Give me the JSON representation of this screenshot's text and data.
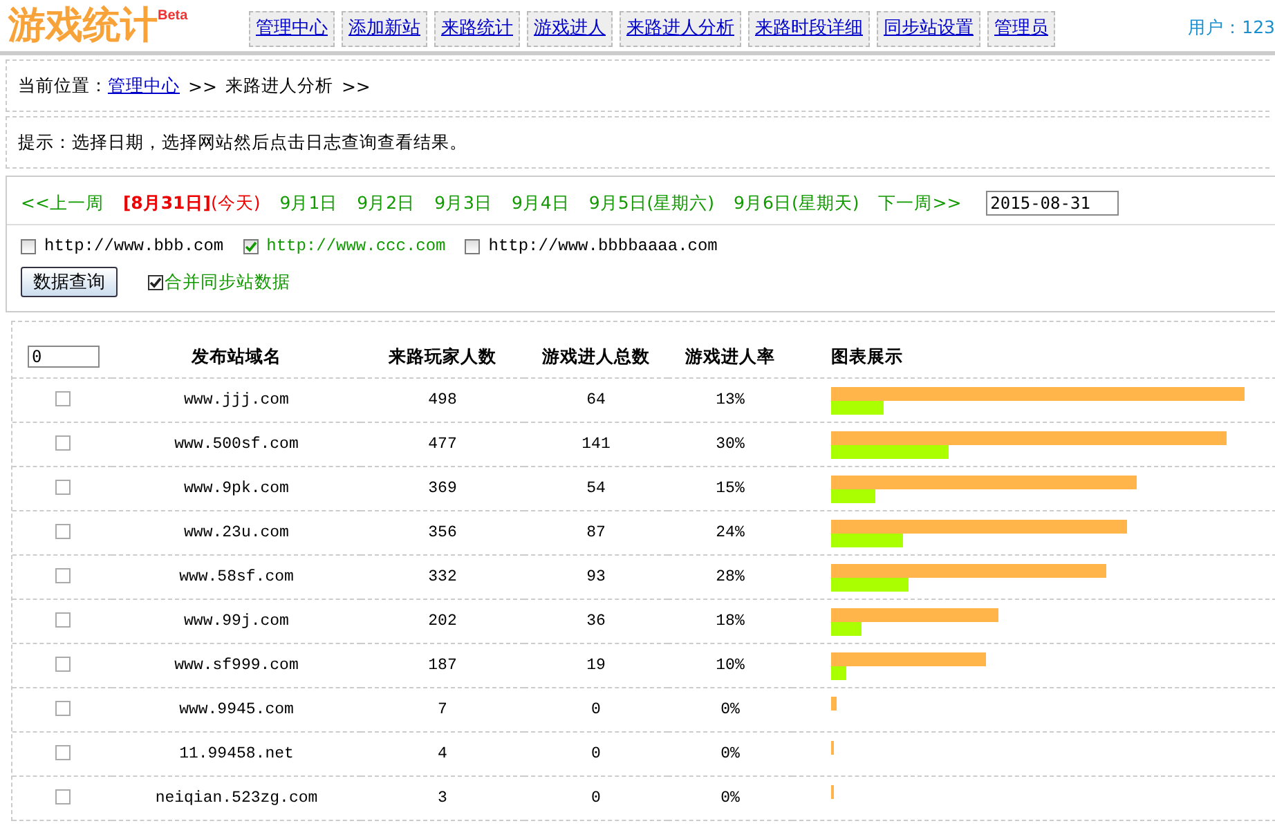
{
  "header": {
    "logo": "游戏统计",
    "logo_badge": "Beta",
    "nav": [
      {
        "label": "管理中心"
      },
      {
        "label": "添加新站"
      },
      {
        "label": "来路统计"
      },
      {
        "label": "游戏进人"
      },
      {
        "label": "来路进人分析"
      },
      {
        "label": "来路时段详细"
      },
      {
        "label": "同步站设置"
      },
      {
        "label": "管理员"
      }
    ],
    "user": "用户：123"
  },
  "breadcrumb": {
    "label": "当前位置：",
    "link": "管理中心",
    "separator": ">>",
    "current": "来路进人分析",
    "trail": ">>"
  },
  "hint": "提示：选择日期，选择网站然后点击日志查询查看结果。",
  "dates": {
    "items": [
      {
        "kind": "nav",
        "label": "<<上一周"
      },
      {
        "kind": "day",
        "label": "[8月31日]",
        "suffix": "(今天)",
        "selected": true
      },
      {
        "kind": "day",
        "label": "9月1日",
        "selected": false
      },
      {
        "kind": "day",
        "label": "9月2日",
        "selected": false
      },
      {
        "kind": "day",
        "label": "9月3日",
        "selected": false
      },
      {
        "kind": "day",
        "label": "9月4日",
        "selected": false
      },
      {
        "kind": "day",
        "label": "9月5日(星期六)",
        "selected": false
      },
      {
        "kind": "day",
        "label": "9月6日(星期天)",
        "selected": false
      },
      {
        "kind": "nav",
        "label": "下一周>>"
      }
    ],
    "date_value": "2015-08-31"
  },
  "sites": [
    {
      "label": "http://www.bbb.com",
      "checked": false
    },
    {
      "label": "http://www.ccc.com",
      "checked": true
    },
    {
      "label": "http://www.bbbbaaaa.com",
      "checked": false
    }
  ],
  "query_button": "数据查询",
  "merge": {
    "label": "合并同步站数据",
    "checked": true
  },
  "table": {
    "filter_value": "0",
    "columns": [
      "发布站域名",
      "来路玩家人数",
      "游戏进人总数",
      "游戏进人率",
      "图表展示"
    ],
    "rows": [
      {
        "checked": false,
        "domain": "www.jjj.com",
        "players": "498",
        "entries": "64",
        "rate": "13%"
      },
      {
        "checked": false,
        "domain": "www.500sf.com",
        "players": "477",
        "entries": "141",
        "rate": "30%"
      },
      {
        "checked": false,
        "domain": "www.9pk.com",
        "players": "369",
        "entries": "54",
        "rate": "15%"
      },
      {
        "checked": false,
        "domain": "www.23u.com",
        "players": "356",
        "entries": "87",
        "rate": "24%"
      },
      {
        "checked": false,
        "domain": "www.58sf.com",
        "players": "332",
        "entries": "93",
        "rate": "28%"
      },
      {
        "checked": false,
        "domain": "www.99j.com",
        "players": "202",
        "entries": "36",
        "rate": "18%"
      },
      {
        "checked": false,
        "domain": "www.sf999.com",
        "players": "187",
        "entries": "19",
        "rate": "10%"
      },
      {
        "checked": false,
        "domain": "www.9945.com",
        "players": "7",
        "entries": "0",
        "rate": "0%"
      },
      {
        "checked": false,
        "domain": "11.99458.net",
        "players": "4",
        "entries": "0",
        "rate": "0%"
      },
      {
        "checked": false,
        "domain": "neiqian.523zg.com",
        "players": "3",
        "entries": "0",
        "rate": "0%"
      }
    ]
  }
}
